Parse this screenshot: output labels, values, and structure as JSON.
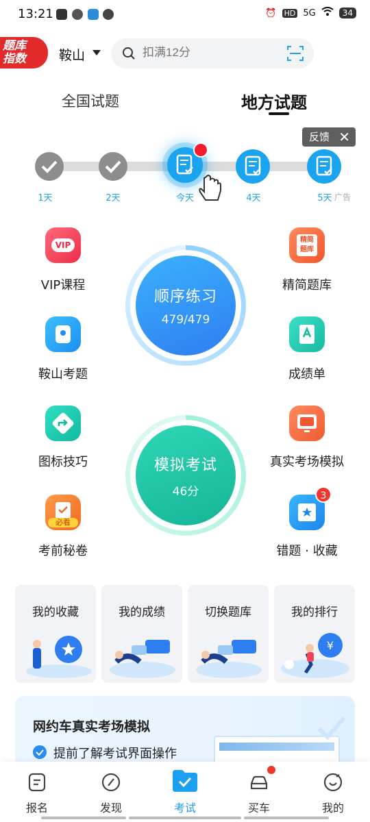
{
  "status_bar": {
    "time": "13:21",
    "network": "5G",
    "battery": "34"
  },
  "header": {
    "logo_text": "题库指数",
    "city": "鞍山",
    "search_placeholder": "扣满12分"
  },
  "tabs": {
    "national": "全国试题",
    "local": "地方试题",
    "active": "local"
  },
  "feedback": {
    "label": "反馈",
    "close": "✕"
  },
  "progress": {
    "days": [
      {
        "label": "1天",
        "state": "done"
      },
      {
        "label": "2天",
        "state": "done"
      },
      {
        "label": "今天",
        "state": "today"
      },
      {
        "label": "4天",
        "state": "todo"
      },
      {
        "label": "5天",
        "state": "todo"
      }
    ],
    "ad_tag": "广告"
  },
  "features": {
    "vip": "VIP课程",
    "vip_badge": "VIP",
    "refined": "精简题库",
    "refined_badge": "精简\n题库",
    "local_exam": "鞍山考题",
    "score_sheet": "成绩单",
    "sign_skills": "图标技巧",
    "real_exam": "真实考场模拟",
    "secret": "考前秘卷",
    "secret_badge": "必看",
    "mistakes": "错题 · 收藏",
    "mistakes_count": "3"
  },
  "practice": {
    "title": "顺序练习",
    "progress_text": "479/479",
    "progress": 1.0
  },
  "mock": {
    "title": "模拟考试",
    "score": "46分"
  },
  "cards": [
    {
      "title": "我的收藏"
    },
    {
      "title": "我的成绩"
    },
    {
      "title": "切换题库"
    },
    {
      "title": "我的排行"
    }
  ],
  "promo": {
    "title": "网约车真实考场模拟",
    "point": "提前了解考试界面操作"
  },
  "nav": [
    {
      "label": "报名"
    },
    {
      "label": "发现"
    },
    {
      "label": "考试"
    },
    {
      "label": "买车"
    },
    {
      "label": "我的"
    }
  ],
  "colors": {
    "accent_blue": "#1aa4f0",
    "practice_blue": "#2e8ff2",
    "mock_green": "#1cc4a4",
    "badge_red": "#f21c2c"
  }
}
